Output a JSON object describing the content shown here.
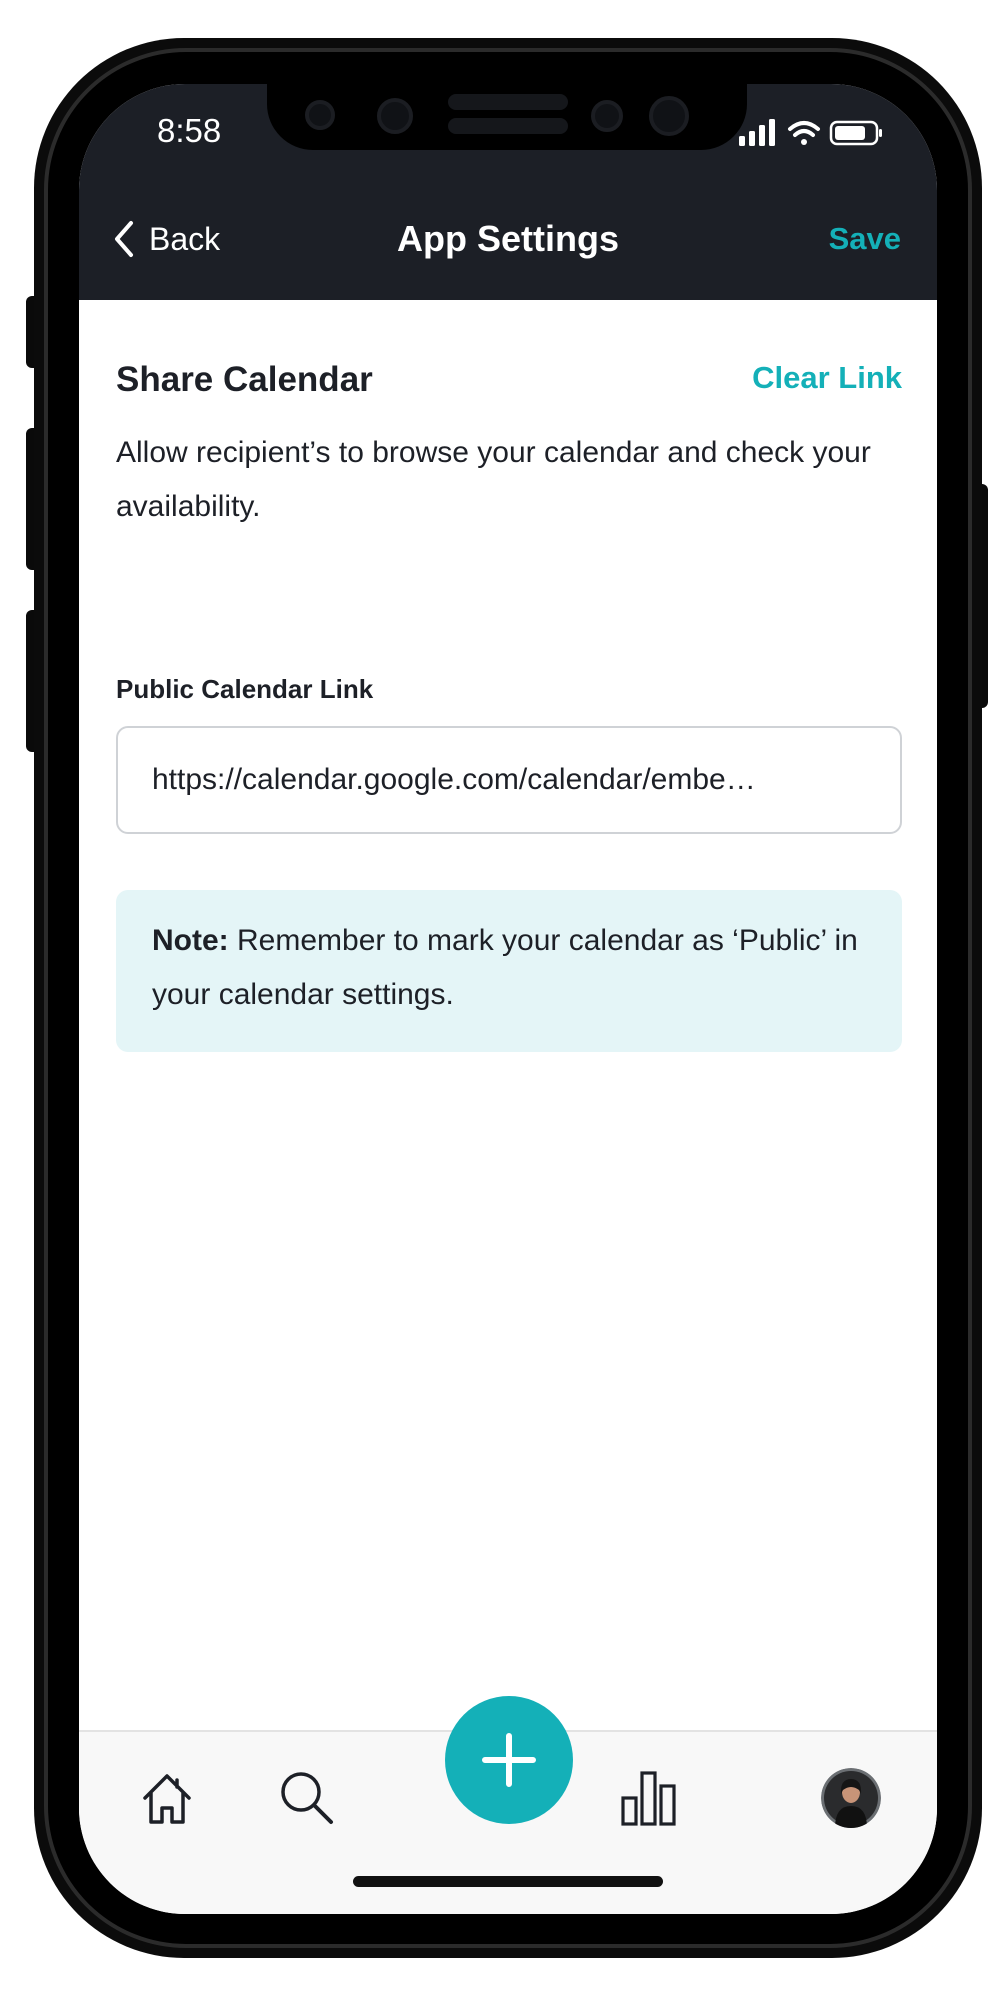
{
  "status_bar": {
    "time": "8:58",
    "icons": [
      "signal-icon",
      "wifi-icon",
      "battery-icon"
    ]
  },
  "nav": {
    "back_label": "Back",
    "title": "App Settings",
    "save_label": "Save"
  },
  "share_calendar": {
    "title": "Share Calendar",
    "clear_link_label": "Clear Link",
    "description": "Allow recipient’s to browse your calendar and check your availability.",
    "field_label": "Public Calendar Link",
    "link_value": "https://calendar.google.com/calendar/embe…",
    "note_prefix": "Note:",
    "note_text": " Remember to mark your calendar as ‘Public’ in your calendar settings."
  },
  "tab_bar": {
    "items": [
      "home-icon",
      "search-icon",
      "add-icon",
      "stats-icon",
      "profile-avatar"
    ]
  },
  "colors": {
    "accent": "#14b0b8",
    "header_bg": "#1c1f26",
    "note_bg": "#e4f5f7",
    "text": "#1d2027"
  }
}
